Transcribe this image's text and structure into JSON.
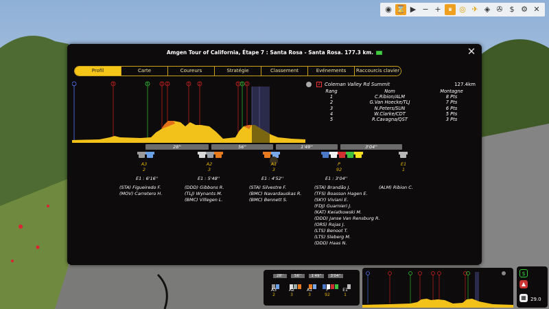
{
  "panel": {
    "title": "Amgen Tour of California, Étape 7 : Santa Rosa - Santa Rosa. 177.3 km.",
    "tabs": [
      {
        "label": "Profil",
        "active": true
      },
      {
        "label": "Carte",
        "active": false
      },
      {
        "label": "Coureurs",
        "active": false
      },
      {
        "label": "Stratégie",
        "active": false
      },
      {
        "label": "Classement",
        "active": false
      },
      {
        "label": "Evénements",
        "active": false
      },
      {
        "label": "Raccourcis clavier",
        "active": false
      }
    ]
  },
  "climb": {
    "category": "2",
    "name": "Coleman Valley Rd Summit",
    "km": "127.4km",
    "headers": {
      "rank": "Rang",
      "name": "Nom",
      "points": "Montagne"
    },
    "rows": [
      {
        "rank": "1",
        "name": "C.Ribion/ALM",
        "points": "8 Pts"
      },
      {
        "rank": "2",
        "name": "G.Van Hoecke/TLJ",
        "points": "7 Pts"
      },
      {
        "rank": "3",
        "name": "N.Peters/SUN",
        "points": "6 Pts"
      },
      {
        "rank": "4",
        "name": "W.Clarke/CDT",
        "points": "5 Pts"
      },
      {
        "rank": "5",
        "name": "R.Cavagna/QST",
        "points": "3 Pts"
      }
    ]
  },
  "profile_markers": [
    "3",
    "5",
    "3",
    "2",
    "3",
    "2",
    "3",
    "5",
    "2"
  ],
  "gaps": [
    "28''",
    "56''",
    "1'49''",
    "3'04''"
  ],
  "groups": [
    {
      "label": "A3",
      "count": "2",
      "time": "E1 : 6'16''",
      "names": "(STA) Figueiredo F.\n(MOV) Carretero H."
    },
    {
      "label": "A2",
      "count": "3",
      "time": "E1 : 5'48''",
      "names": "(DDD) Gibbons R.\n(TLJ) Wynants M.\n(BMC) Villegen L."
    },
    {
      "label": "A1",
      "count": "3",
      "time": "E1 : 4'52''",
      "names": "(STA) Silvestre F.\n(BMC) Navardauskas R.\n(BMC) Bennett S."
    },
    {
      "label": "P",
      "count": "92",
      "time": "E1 : 3'04''",
      "names": "(STA) Brandão J.\n(TFS) Boasson Hagen E.\n(SKY) Viviani E.\n(FDJ) Guarnieri J.\n(KAT) Kwiatkowski M.\n(DDD) Janse Van Rensburg R.\n(ORS) Rojas J.\n(LTS) Benoot T.\n(LTS) Sleberg M.\n(DDD) Haas N."
    },
    {
      "label": "E1",
      "count": "1",
      "time": "",
      "names": "(ALM) Ribion C."
    }
  ],
  "mini": {
    "gaps": [
      "28''",
      "56''",
      "1'49''",
      "3'04''"
    ],
    "labels": [
      {
        "l": "A3",
        "c": "2"
      },
      {
        "l": "A2",
        "c": "3"
      },
      {
        "l": "A1",
        "c": "3"
      },
      {
        "l": "P",
        "c": "92"
      },
      {
        "l": "E1",
        "c": "1"
      }
    ]
  },
  "speed": "29.0",
  "colors": {
    "accent": "#f5c518",
    "panel": "#0d0b0b"
  }
}
